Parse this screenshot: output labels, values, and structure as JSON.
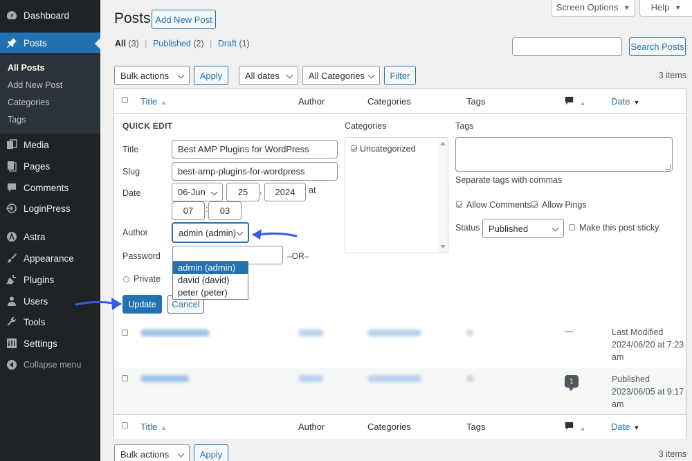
{
  "sidebar": {
    "items": [
      {
        "label": "Dashboard",
        "icon": "dashboard-icon"
      },
      {
        "label": "Posts",
        "icon": "pin-icon"
      },
      {
        "label": "Media",
        "icon": "media-icon"
      },
      {
        "label": "Pages",
        "icon": "pages-icon"
      },
      {
        "label": "Comments",
        "icon": "comments-icon"
      },
      {
        "label": "LoginPress",
        "icon": "loginpress-icon"
      },
      {
        "label": "Astra",
        "icon": "astra-icon"
      },
      {
        "label": "Appearance",
        "icon": "brush-icon"
      },
      {
        "label": "Plugins",
        "icon": "plugin-icon"
      },
      {
        "label": "Users",
        "icon": "users-icon"
      },
      {
        "label": "Tools",
        "icon": "wrench-icon"
      },
      {
        "label": "Settings",
        "icon": "settings-icon"
      }
    ],
    "submenu": [
      "All Posts",
      "Add New Post",
      "Categories",
      "Tags"
    ],
    "collapse_label": "Collapse menu"
  },
  "top": {
    "screen_options": "Screen Options",
    "help": "Help"
  },
  "header": {
    "title": "Posts",
    "add_new": "Add New Post"
  },
  "views": {
    "all": "All",
    "all_count": "(3)",
    "published": "Published",
    "published_count": "(2)",
    "draft": "Draft",
    "draft_count": "(1)",
    "sep": "|"
  },
  "search": {
    "button": "Search Posts",
    "value": ""
  },
  "tablenav": {
    "bulk_actions": "Bulk actions",
    "apply": "Apply",
    "all_dates": "All dates",
    "all_categories": "All Categories",
    "filter": "Filter",
    "items_count": "3 items"
  },
  "columns": {
    "title": "Title",
    "author": "Author",
    "categories": "Categories",
    "tags": "Tags",
    "date": "Date"
  },
  "quick_edit": {
    "heading": "QUICK EDIT",
    "title_label": "Title",
    "title_value": "Best AMP Plugins for WordPress",
    "slug_label": "Slug",
    "slug_value": "best-amp-plugins-for-wordpress",
    "date_label": "Date",
    "month": "06-Jun",
    "day": "25",
    "comma": ",",
    "year": "2024",
    "at": "at",
    "hour": "07",
    "colon": ":",
    "minute": "03",
    "author_label": "Author",
    "author_value": "admin (admin)",
    "author_options": [
      "admin (admin)",
      "david (david)",
      "peter (peter)"
    ],
    "password_label": "Password",
    "or_label": "–OR–",
    "private_label": "Private",
    "categories_label": "Categories",
    "category_item": "Uncategorized",
    "tags_label": "Tags",
    "tags_hint": "Separate tags with commas",
    "allow_comments": "Allow Comments",
    "allow_pings": "Allow Pings",
    "status_label": "Status",
    "status_value": "Published",
    "sticky_label": "Make this post sticky",
    "update": "Update",
    "cancel": "Cancel"
  },
  "rows": [
    {
      "tags": "—",
      "comments": "—",
      "date_status": "Last Modified",
      "date_value": "2024/06/20 at 7:23",
      "date_suffix": "am"
    },
    {
      "tags": "—",
      "comments": "1",
      "date_status": "Published",
      "date_value": "2023/06/05 at 9:17",
      "date_suffix": "am"
    }
  ],
  "colors": {
    "accent": "#2271b1",
    "sidebar": "#1d2327",
    "arrow": "#3858e9"
  }
}
